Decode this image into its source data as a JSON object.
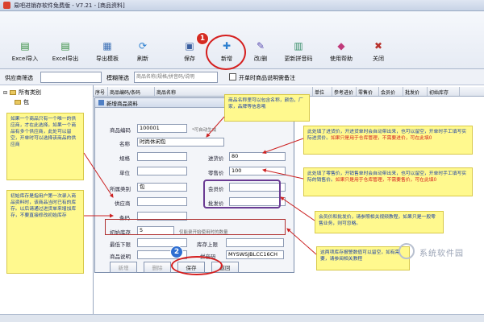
{
  "window": {
    "title": "易吧进销存软件免费版 - V7.21 - [商品资料]"
  },
  "toolbar": {
    "buttons": [
      {
        "label": "Excel导入",
        "icon": "excel-import-icon",
        "glyph": "▤",
        "color": "#2f8a3a"
      },
      {
        "label": "Excel导出",
        "icon": "excel-export-icon",
        "glyph": "▤",
        "color": "#2f8a3a"
      },
      {
        "label": "导出模板",
        "icon": "template-icon",
        "glyph": "▦",
        "color": "#3b6fb5"
      },
      {
        "label": "刷新",
        "icon": "refresh-icon",
        "glyph": "⟳",
        "color": "#2d7fd0"
      },
      {
        "label": "保存",
        "icon": "save-icon",
        "glyph": "▣",
        "color": "#3a5fa0"
      },
      {
        "label": "新增",
        "icon": "add-icon",
        "glyph": "✚",
        "color": "#2d7fd0"
      },
      {
        "label": "改/删",
        "icon": "edit-icon",
        "glyph": "✎",
        "color": "#5a4bb0"
      },
      {
        "label": "更新拼音码",
        "icon": "pinyin-icon",
        "glyph": "▥",
        "color": "#3a8f6a"
      },
      {
        "label": "使用帮助",
        "icon": "help-icon",
        "glyph": "◆",
        "color": "#c03a7a"
      },
      {
        "label": "关闭",
        "icon": "close-icon",
        "glyph": "✖",
        "color": "#b8322c"
      }
    ]
  },
  "filter": {
    "supplier_label": "供应商筛选",
    "fuzzy_label": "模糊筛选",
    "fuzzy_placeholder": "商品名称/规格/拼音码/说明",
    "checkbox_label": "开单时商品说明需备注"
  },
  "tree": {
    "root": "所有类别",
    "child": "包"
  },
  "grid": {
    "columns": [
      "序号",
      "商品编码/条码",
      "商品名称",
      "单位",
      "参考进价",
      "零售价",
      "会员价",
      "批发价",
      "初始库存"
    ]
  },
  "dialog": {
    "title": "新增商品资料",
    "fields": {
      "code_label": "商品编码",
      "code_value": "100001",
      "code_hint": "*可自动生成",
      "name_label": "名称",
      "name_value": "时尚休闲包",
      "spec_label": "规格",
      "unit_label": "单位",
      "category_label": "所属类别",
      "category_value": "包",
      "supplier_label": "供应商",
      "barcode_label": "条码",
      "purchase_label": "进货价",
      "purchase_value": "80",
      "retail_label": "零售价",
      "retail_value": "100",
      "member_label": "会员价",
      "wholesale_label": "批发价",
      "stock_label": "初始库存",
      "stock_value": "5",
      "stock_hint": "仅能录开始使用时的数量",
      "min_label": "最低下限",
      "max_label": "库存上限",
      "desc_label": "商品说明",
      "pinyin_label": "拼音码",
      "pinyin_value": "MYSWSJBLCC16CH"
    },
    "buttons": {
      "add": "新增",
      "delete": "删除",
      "save": "保存",
      "back": "返回"
    }
  },
  "callouts": {
    "top": "商品名称里可以包含名称，颜色，厂家，品牌等信息哦",
    "left_top": "如果一个商品只有一个唯一的供应商，才在此选择。如果一个商品有多个供应商，此处可以留空，开单时可以选择该商品的供应商",
    "left_bottom": "初始库存是指用户第一次录入商品资料时，该商品当时已有的库存。以后请通过进货单来增加库存，不要直接修改初始库存",
    "right_1": "此处填了进货价，开进货单时会自动带出来，也可以留空，开单时手工填写实际进货价。",
    "right_1_red": "如果只是用于仓库管理，不需要进价，可在此填0",
    "right_2": "此处填了零售价，开销售单时会自动带出来，也可以留空，开单时手工填写实际的销售价。",
    "right_2_red": "如果只是用于仓库管理，不需要售价，可在此填0",
    "right_3": "会员价和批发价，请参照相关视频教程，如果只是一般零售业务，则可忽略。",
    "right_4": "这两项库存报警数值可以留空，如有需要，请参阅相关教程"
  },
  "badges": {
    "one": "1",
    "two": "2"
  },
  "watermark": {
    "text": "系统软件园"
  }
}
